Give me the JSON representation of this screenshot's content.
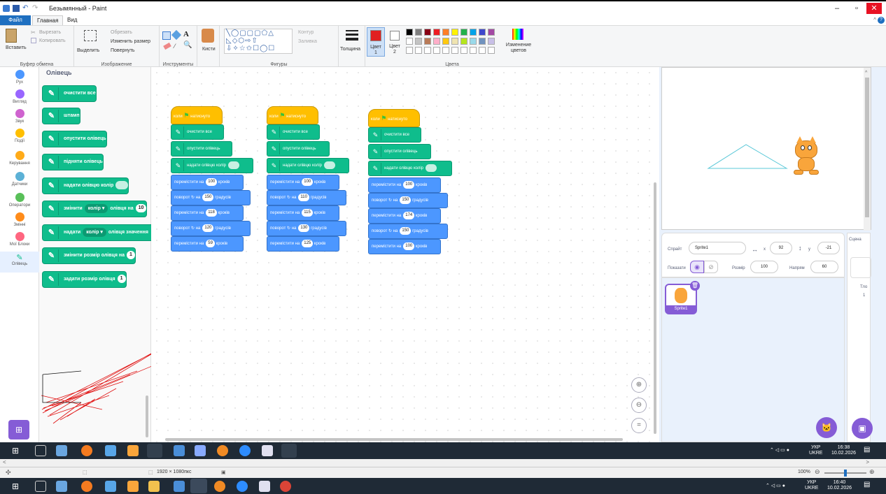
{
  "paint": {
    "title": "Безымянный - Paint",
    "tabs": [
      "Файл",
      "Главная",
      "Вид"
    ],
    "clipboard": {
      "paste": "Вставить",
      "cut": "Вырезать",
      "copy": "Копировать",
      "label": "Буфер обмена"
    },
    "image": {
      "select": "Выделить",
      "crop": "Обрезать",
      "resize": "Изменить размер",
      "rotate": "Повернуть",
      "label": "Изображение"
    },
    "tools": {
      "label": "Инструменты",
      "brushes": "Кисти"
    },
    "shapes": {
      "label": "Фигуры",
      "outline": "Контур",
      "fill": "Заливка"
    },
    "size_label": "Толщина",
    "color1": "Цвет 1",
    "color2": "Цвет 2",
    "colors_label": "Цвета",
    "edit_colors": "Изменение цветов",
    "status_size": "1920 × 1080пкс",
    "zoom": "100%"
  },
  "scratch": {
    "categories": [
      {
        "label": "Рух",
        "color": "#4c97ff"
      },
      {
        "label": "Вигляд",
        "color": "#9966ff"
      },
      {
        "label": "Звук",
        "color": "#cf63cf"
      },
      {
        "label": "Події",
        "color": "#ffbf00"
      },
      {
        "label": "Керування",
        "color": "#ffab19"
      },
      {
        "label": "Датчики",
        "color": "#5cb1d6"
      },
      {
        "label": "Оператори",
        "color": "#59c059"
      },
      {
        "label": "Змінні",
        "color": "#ff8c1a"
      },
      {
        "label": "Мої Блоки",
        "color": "#ff6680"
      },
      {
        "label": "Олівець",
        "color": "#0fbd8c"
      }
    ],
    "palette_title": "Олівець",
    "palette": {
      "clear": "очистити все",
      "stamp": "штамп",
      "pen_down": "опустити олівець",
      "pen_up": "підняти олівець",
      "set_color": "надати олівцю колір",
      "change_pre": "змінити",
      "change_dd": "колір",
      "change_post": "олівця на",
      "change_val": "10",
      "set_pre": "надати",
      "set_dd": "колір",
      "set_post": "олівця значення",
      "change_size": "змінити розмір олівця на",
      "change_size_val": "1",
      "set_size": "задати розмір олівця",
      "set_size_val": "1"
    },
    "hat": "коли",
    "hat2": "натиснуто",
    "b_clear": "очистити все",
    "b_down": "опустити олівець",
    "b_color": "надати олівцю колір",
    "move": "перемістити на",
    "steps": "кроків",
    "turn": "поворот",
    "on": "на",
    "deg": "градусів",
    "scripts": [
      {
        "moves": [
          "100",
          "118",
          "59"
        ],
        "turns": [
          "150",
          "120"
        ]
      },
      {
        "moves": [
          "100",
          "115",
          "125"
        ],
        "turns": [
          "110",
          "130"
        ]
      },
      {
        "moves": [
          "100",
          "174",
          "100"
        ],
        "turns": [
          "150",
          "150"
        ]
      }
    ],
    "sprite": {
      "label": "Спрайт",
      "name": "Sprite1",
      "x_label": "x",
      "x": "92",
      "y_label": "y",
      "y": "-21",
      "show_label": "Показати",
      "size_label": "Розмір",
      "size": "100",
      "dir_label": "Напрям",
      "direction": "60"
    },
    "stage_tab": "Сцена",
    "backdrops_label": "Тло",
    "backdrops_count": "1",
    "sprite_tile": "Sprite1"
  },
  "taskbar": {
    "lang": "УКР",
    "layout": "UKRE",
    "time1": "16:38",
    "date1": "10.02.2026",
    "time2": "16:40",
    "date2": "10.02.2026"
  }
}
